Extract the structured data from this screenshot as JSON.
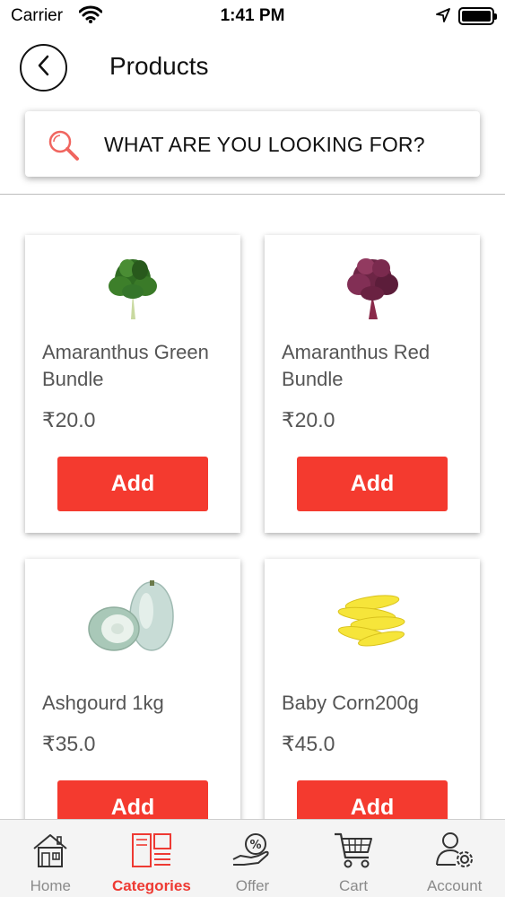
{
  "status_bar": {
    "carrier": "Carrier",
    "time": "1:41 PM"
  },
  "header": {
    "title": "Products",
    "back_icon": "chevron-left-icon"
  },
  "search": {
    "placeholder": "WHAT ARE YOU LOOKING FOR?",
    "icon": "search-icon"
  },
  "products": [
    {
      "name": "Amaranthus Green Bundle",
      "price": "₹20.0",
      "add_label": "Add",
      "image": "green-leafy-bundle"
    },
    {
      "name": "Amaranthus Red Bundle",
      "price": "₹20.0",
      "add_label": "Add",
      "image": "red-leafy-bundle"
    },
    {
      "name": "Ashgourd 1kg",
      "price": "₹35.0",
      "add_label": "Add",
      "image": "ash-gourd"
    },
    {
      "name": "Baby Corn200g",
      "price": "₹45.0",
      "add_label": "Add",
      "image": "baby-corn"
    }
  ],
  "tabs": [
    {
      "label": "Home",
      "icon": "home-icon",
      "active": false
    },
    {
      "label": "Categories",
      "icon": "categories-icon",
      "active": true
    },
    {
      "label": "Offer",
      "icon": "offer-icon",
      "active": false
    },
    {
      "label": "Cart",
      "icon": "cart-icon",
      "active": false
    },
    {
      "label": "Account",
      "icon": "account-settings-icon",
      "active": false
    }
  ],
  "colors": {
    "accent": "#f43a2f",
    "tab_active": "#ee3a33",
    "tab_inactive": "#8a8a8a"
  }
}
